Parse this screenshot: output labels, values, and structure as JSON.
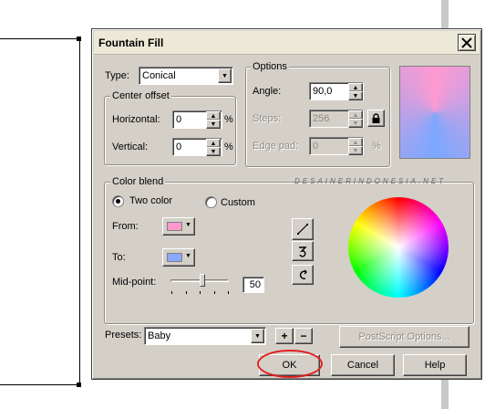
{
  "dialog": {
    "title": "Fountain Fill"
  },
  "type": {
    "label": "Type:",
    "value": "Conical"
  },
  "center_offset": {
    "title": "Center offset",
    "horizontal_label": "Horizontal:",
    "horizontal_value": "0",
    "vertical_label": "Vertical:",
    "vertical_value": "0",
    "unit": "%"
  },
  "options": {
    "title": "Options",
    "angle_label": "Angle:",
    "angle_value": "90,0",
    "steps_label": "Steps:",
    "steps_value": "256",
    "edge_pad_label": "Edge pad:",
    "edge_pad_value": "0",
    "unit": "%"
  },
  "color_blend": {
    "title": "Color blend",
    "two_color_label": "Two color",
    "custom_label": "Custom",
    "selected_mode": "Two color",
    "from_label": "From:",
    "from_color": "#ff99cc",
    "to_label": "To:",
    "to_color": "#8aa8ff",
    "midpoint_label": "Mid-point:",
    "midpoint_value": "50"
  },
  "watermark": "DESAINERINDONESIA.NET",
  "presets": {
    "label": "Presets:",
    "value": "Baby"
  },
  "buttons": {
    "postscript": "PostScript Options...",
    "ok": "OK",
    "cancel": "Cancel",
    "help": "Help",
    "add_preset": "+",
    "remove_preset": "−"
  },
  "icons": {
    "close": "close-icon",
    "lock": "lock-icon",
    "direct_blend": "direct-blend-icon",
    "ccw_blend": "counterclockwise-blend-icon",
    "cw_blend": "clockwise-blend-icon"
  },
  "highlight_color": "#e02020"
}
